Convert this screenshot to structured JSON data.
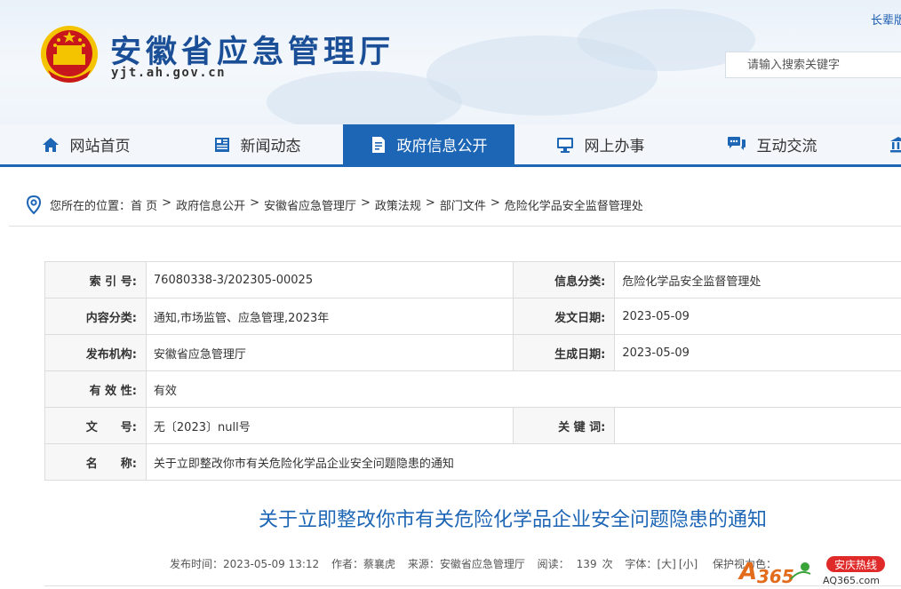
{
  "header": {
    "site_title": "安徽省应急管理厅",
    "site_domain": "yjt.ah.gov.cn",
    "top_link": "长辈版",
    "search_placeholder": "请输入搜索关键字"
  },
  "colors": {
    "primary": "#1d66b6",
    "title_blue": "#1a4e96",
    "emblem_red": "#c8161d",
    "emblem_gold": "#f5c400"
  },
  "nav": {
    "items": [
      {
        "label": "网站首页",
        "icon": "home-icon"
      },
      {
        "label": "新闻动态",
        "icon": "newspaper-icon"
      },
      {
        "label": "政府信息公开",
        "icon": "document-icon",
        "active": true
      },
      {
        "label": "网上办事",
        "icon": "monitor-icon"
      },
      {
        "label": "互动交流",
        "icon": "chat-icon"
      },
      {
        "label": "",
        "icon": "bank-icon"
      }
    ]
  },
  "breadcrumb": {
    "prefix": "您所在的位置：",
    "items": [
      "首 页",
      "政府信息公开",
      "安徽省应急管理厅",
      "政策法规",
      "部门文件",
      "危险化学品安全监督管理处"
    ]
  },
  "info": {
    "index_label": "索 引 号:",
    "index_value": "76080338-3/202305-00025",
    "category_label": "信息分类:",
    "category_value": "危险化学品安全监督管理处",
    "content_label": "内容分类:",
    "content_value": "通知,市场监管、应急管理,2023年",
    "issue_date_label": "发文日期:",
    "issue_date_value": "2023-05-09",
    "publisher_label": "发布机构:",
    "publisher_value": "安徽省应急管理厅",
    "created_date_label": "生成日期:",
    "created_date_value": "2023-05-09",
    "validity_label": "有 效 性:",
    "validity_value": "有效",
    "doc_no_label": "文　　号:",
    "doc_no_value": "无〔2023〕null号",
    "keywords_label": "关 键 词:",
    "keywords_value": "",
    "name_label": "名　　称:",
    "name_value": "关于立即整改你市有关危险化学品企业安全问题隐患的通知"
  },
  "article": {
    "title": "关于立即整改你市有关危险化学品企业安全问题隐患的通知",
    "publish_time": "发布时间：2023-05-09 13:12",
    "author": "作者：蔡襄虎",
    "source": "来源：安徽省应急管理厅",
    "views_label": "阅读：",
    "views": "139",
    "views_unit": "次",
    "font_label": "字体：",
    "font_large": "[大]",
    "font_small": "[小]",
    "eye_care": "保护视力色："
  },
  "watermark": {
    "brand": "A365",
    "badge": "安庆热线",
    "domain": "AQ365.com"
  }
}
